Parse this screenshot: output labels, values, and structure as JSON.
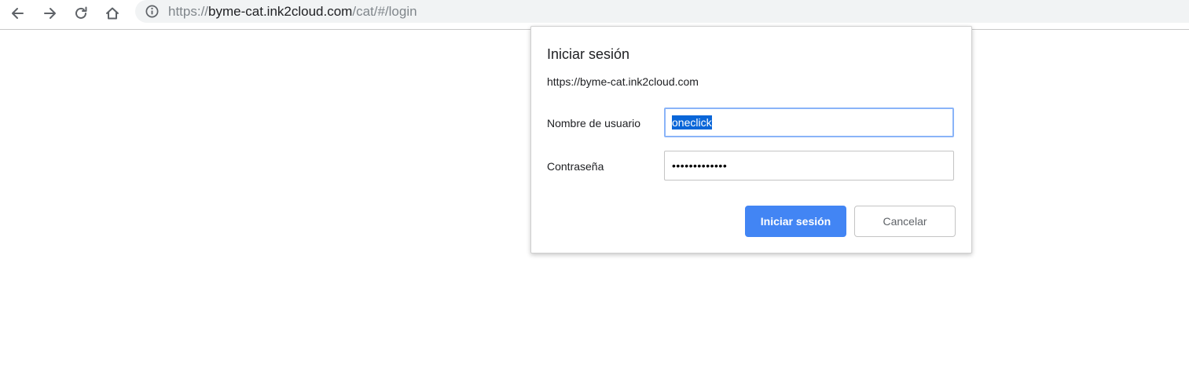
{
  "browser": {
    "back_icon": "arrow-left-icon",
    "forward_icon": "arrow-right-icon",
    "reload_icon": "reload-icon",
    "home_icon": "home-icon",
    "info_icon": "info-circle-icon",
    "url_scheme": "https://",
    "url_host": "byme-cat.ink2cloud.com",
    "url_path": "/cat/#/login"
  },
  "dialog": {
    "title": "Iniciar sesión",
    "origin": "https://byme-cat.ink2cloud.com",
    "username_label": "Nombre de usuario",
    "username_value": "oneclick",
    "password_label": "Contraseña",
    "password_value": "•••••••••••••",
    "submit_label": "Iniciar sesión",
    "cancel_label": "Cancelar"
  },
  "colors": {
    "primary_button": "#4285f4",
    "selection": "#0a66d8",
    "focus_ring": "#8ab4f8"
  }
}
